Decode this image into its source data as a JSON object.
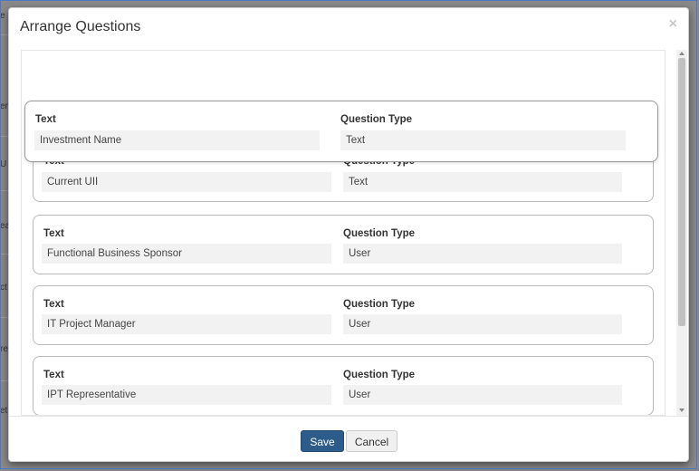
{
  "dialog": {
    "title": "Arrange Questions",
    "close_glyph": "×",
    "save_label": "Save",
    "cancel_label": "Cancel"
  },
  "background_stubs": [
    "e",
    "er",
    "U",
    "ea",
    "ct",
    "re",
    "et"
  ],
  "dragged_card": {
    "text_label": "Text",
    "text_value": "Investment Name",
    "type_label": "Question Type",
    "type_value": "Text"
  },
  "cards": [
    {
      "text_label": "Text",
      "text_value": "Current UII",
      "type_label": "Question Type",
      "type_value": "Text"
    },
    {
      "text_label": "Text",
      "text_value": "Functional Business Sponsor",
      "type_label": "Question Type",
      "type_value": "User"
    },
    {
      "text_label": "Text",
      "text_value": "IT Project Manager",
      "type_label": "Question Type",
      "type_value": "User"
    },
    {
      "text_label": "Text",
      "text_value": "IPT Representative",
      "type_label": "Question Type",
      "type_value": "User"
    }
  ]
}
